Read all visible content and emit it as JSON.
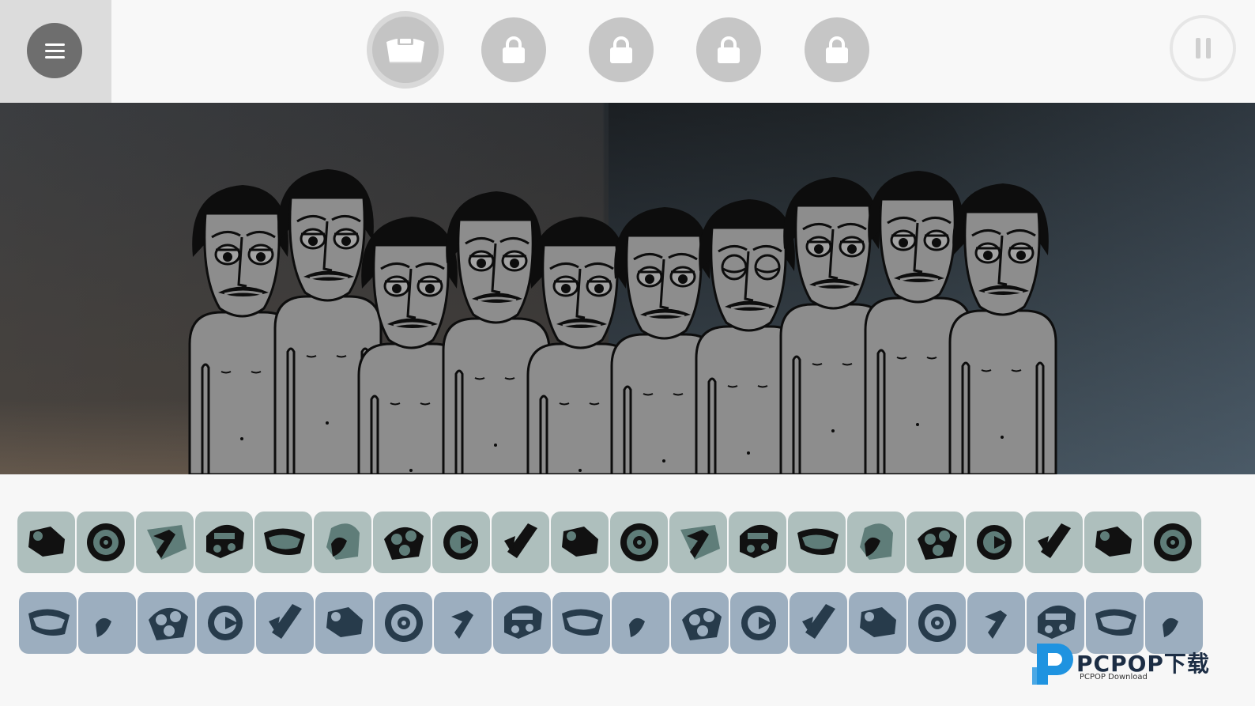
{
  "topbar": {
    "menu_icon": "hamburger-icon",
    "bonus_slots": [
      {
        "state": "unlocked",
        "icon": "cap-icon"
      },
      {
        "state": "locked",
        "icon": "lock-icon"
      },
      {
        "state": "locked",
        "icon": "lock-icon"
      },
      {
        "state": "locked",
        "icon": "lock-icon"
      },
      {
        "state": "locked",
        "icon": "lock-icon"
      }
    ],
    "pause_icon": "pause-icon"
  },
  "stage": {
    "character_count": 10
  },
  "tray1": {
    "icons": [
      "beat-1",
      "disc",
      "effect-1",
      "effect-2",
      "effect-3",
      "effect-4",
      "melody-1",
      "melody-2",
      "melody-3",
      "melody-4",
      "melody-5",
      "voice-1",
      "voice-2",
      "voice-3",
      "voice-4",
      "voice-5",
      "voice-6",
      "voice-7",
      "voice-8",
      "voice-9"
    ]
  },
  "tray2": {
    "icons": [
      "beat-a",
      "beat-b",
      "beat-c",
      "beat-d",
      "effect-a",
      "effect-b",
      "effect-c",
      "effect-d",
      "melody-a",
      "melody-b",
      "melody-c",
      "melody-d",
      "melody-e",
      "voice-a",
      "voice-b",
      "voice-c",
      "voice-d",
      "voice-e",
      "voice-f",
      "voice-g"
    ]
  },
  "colors": {
    "tray1_bg": "#aebfbd",
    "tray1_icon": "#111111",
    "tray1_accent": "#5f7d79",
    "tray2_bg": "#9caebf",
    "tray2_icon": "#273b4b",
    "locked_button": "#c6c6c6"
  },
  "watermark": {
    "name": "PCPOP下载",
    "sub": "PCPOP Download"
  }
}
